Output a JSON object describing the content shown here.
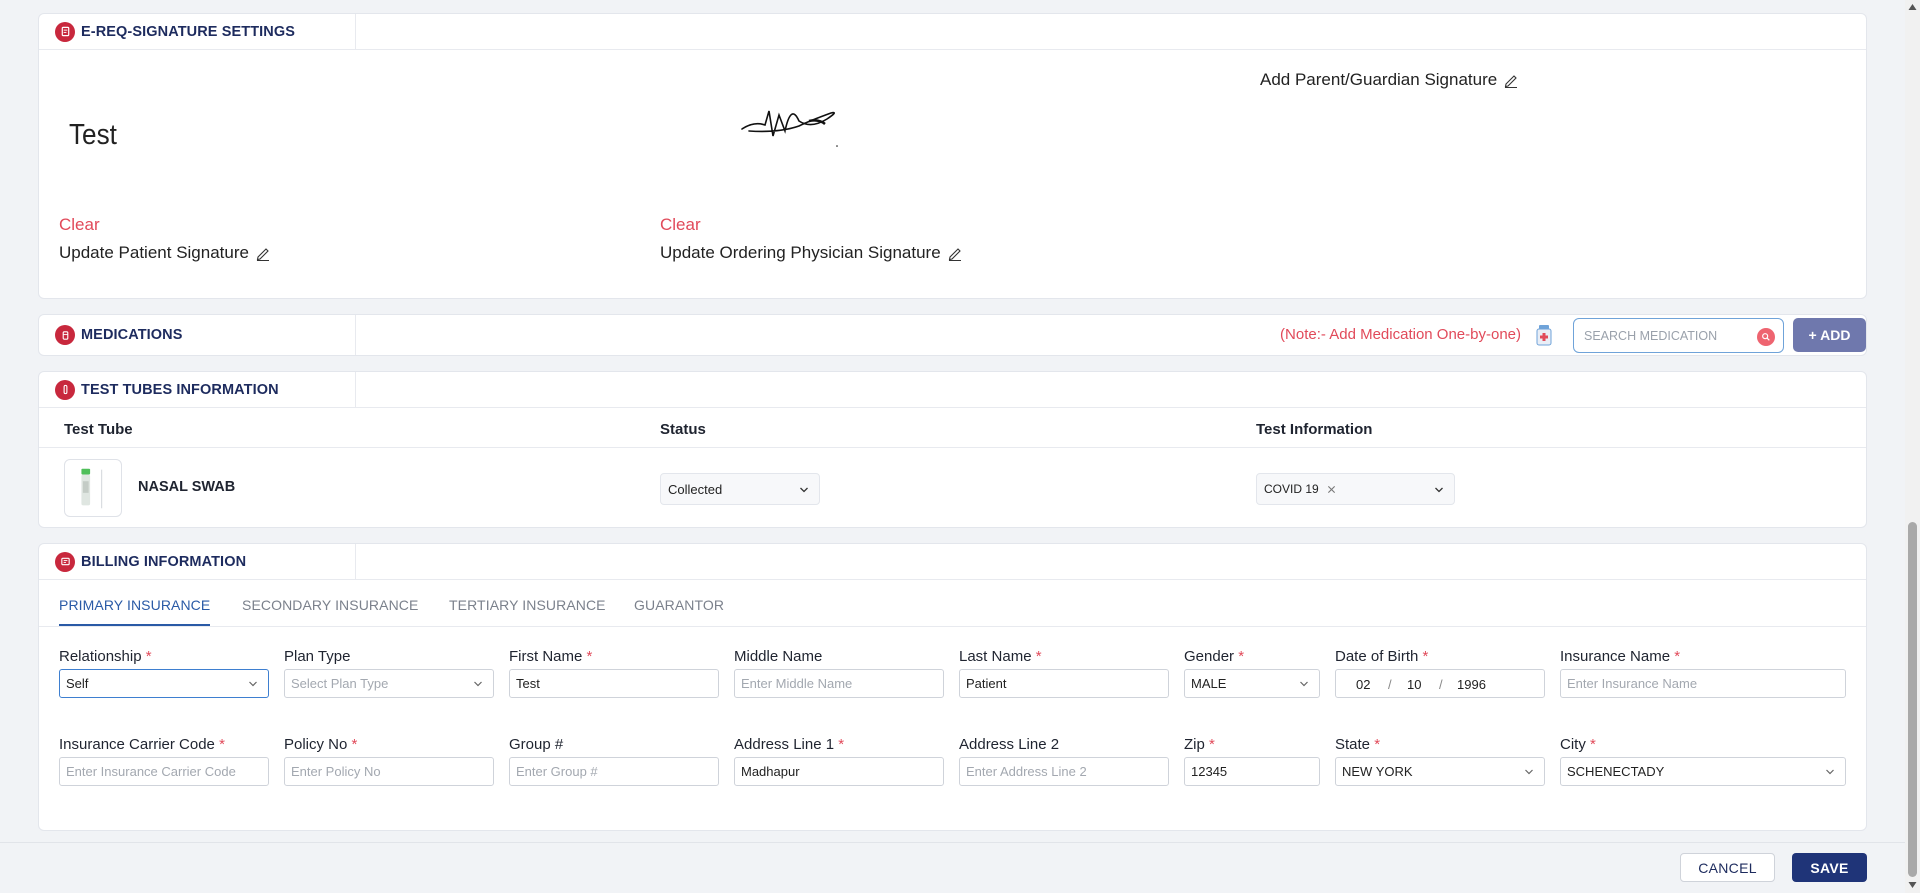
{
  "signature": {
    "title": "E-REQ-SIGNATURE SETTINGS",
    "patient_typed": "Test",
    "clear_label": "Clear",
    "update_patient": "Update Patient Signature",
    "update_physician": "Update Ordering Physician Signature",
    "add_guardian": "Add Parent/Guardian Signature"
  },
  "medications": {
    "title": "MEDICATIONS",
    "note": "(Note:- Add Medication One-by-one)",
    "search_placeholder": "SEARCH MEDICATION",
    "add_label": "+ ADD"
  },
  "test_tubes": {
    "title": "TEST TUBES INFORMATION",
    "columns": [
      "Test Tube",
      "Status",
      "Test Information"
    ],
    "rows": [
      {
        "name": "NASAL SWAB",
        "status": "Collected",
        "tests": [
          "COVID 19"
        ]
      }
    ]
  },
  "billing": {
    "title": "BILLING INFORMATION",
    "tabs": [
      "PRIMARY INSURANCE",
      "SECONDARY INSURANCE",
      "TERTIARY INSURANCE",
      "GUARANTOR"
    ],
    "active_tab": "PRIMARY INSURANCE",
    "fields": {
      "relationship": {
        "label": "Relationship",
        "value": "Self"
      },
      "plan_type": {
        "label": "Plan Type",
        "placeholder": "Select Plan Type"
      },
      "first_name": {
        "label": "First Name",
        "value": "Test"
      },
      "middle_name": {
        "label": "Middle Name",
        "placeholder": "Enter Middle Name"
      },
      "last_name": {
        "label": "Last Name",
        "value": "Patient"
      },
      "gender": {
        "label": "Gender",
        "value": "MALE"
      },
      "dob": {
        "label": "Date of Birth",
        "month": "02",
        "day": "10",
        "year": "1996"
      },
      "insurance_name": {
        "label": "Insurance Name",
        "placeholder": "Enter Insurance Name"
      },
      "carrier_code": {
        "label": "Insurance Carrier Code",
        "placeholder": "Enter Insurance Carrier Code"
      },
      "policy_no": {
        "label": "Policy No",
        "placeholder": "Enter Policy No"
      },
      "group_no": {
        "label": "Group #",
        "placeholder": "Enter Group #"
      },
      "address1": {
        "label": "Address Line 1",
        "value": "Madhapur"
      },
      "address2": {
        "label": "Address Line 2",
        "placeholder": "Enter Address Line 2"
      },
      "zip": {
        "label": "Zip",
        "value": "12345"
      },
      "state": {
        "label": "State",
        "value": "NEW YORK"
      },
      "city": {
        "label": "City",
        "value": "SCHENECTADY"
      }
    }
  },
  "footer": {
    "cancel_label": "CANCEL",
    "save_label": "SAVE"
  },
  "colors": {
    "accent_red": "#c8283d",
    "primary_blue": "#1f3478",
    "link_red": "#e14a5a",
    "tab_blue": "#2a5aa6"
  },
  "icons": [
    "signature-section-icon",
    "medication-section-icon",
    "tube-section-icon",
    "billing-section-icon",
    "pen-icon",
    "pill-bottle-icon",
    "search-icon",
    "chevron-down-icon",
    "close-icon"
  ]
}
